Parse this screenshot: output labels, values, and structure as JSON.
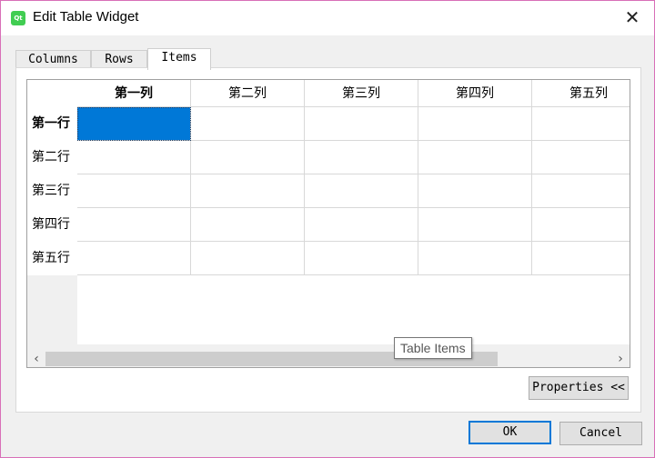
{
  "window": {
    "title": "Edit Table Widget",
    "app_icon_text": "Qt"
  },
  "tabs": [
    {
      "label": "Columns"
    },
    {
      "label": "Rows"
    },
    {
      "label": "Items"
    }
  ],
  "table": {
    "columns": [
      "第一列",
      "第二列",
      "第三列",
      "第四列",
      "第五列"
    ],
    "rows": [
      "第一行",
      "第二行",
      "第三行",
      "第四行",
      "第五行"
    ],
    "selected_cell": {
      "row": 1,
      "column": 1
    }
  },
  "tooltip": {
    "text": "Table Items"
  },
  "buttons": {
    "properties": "Properties <<",
    "ok": "OK",
    "cancel": "Cancel"
  },
  "colors": {
    "selection": "#0078d7",
    "default_button_border": "#0078d7"
  }
}
